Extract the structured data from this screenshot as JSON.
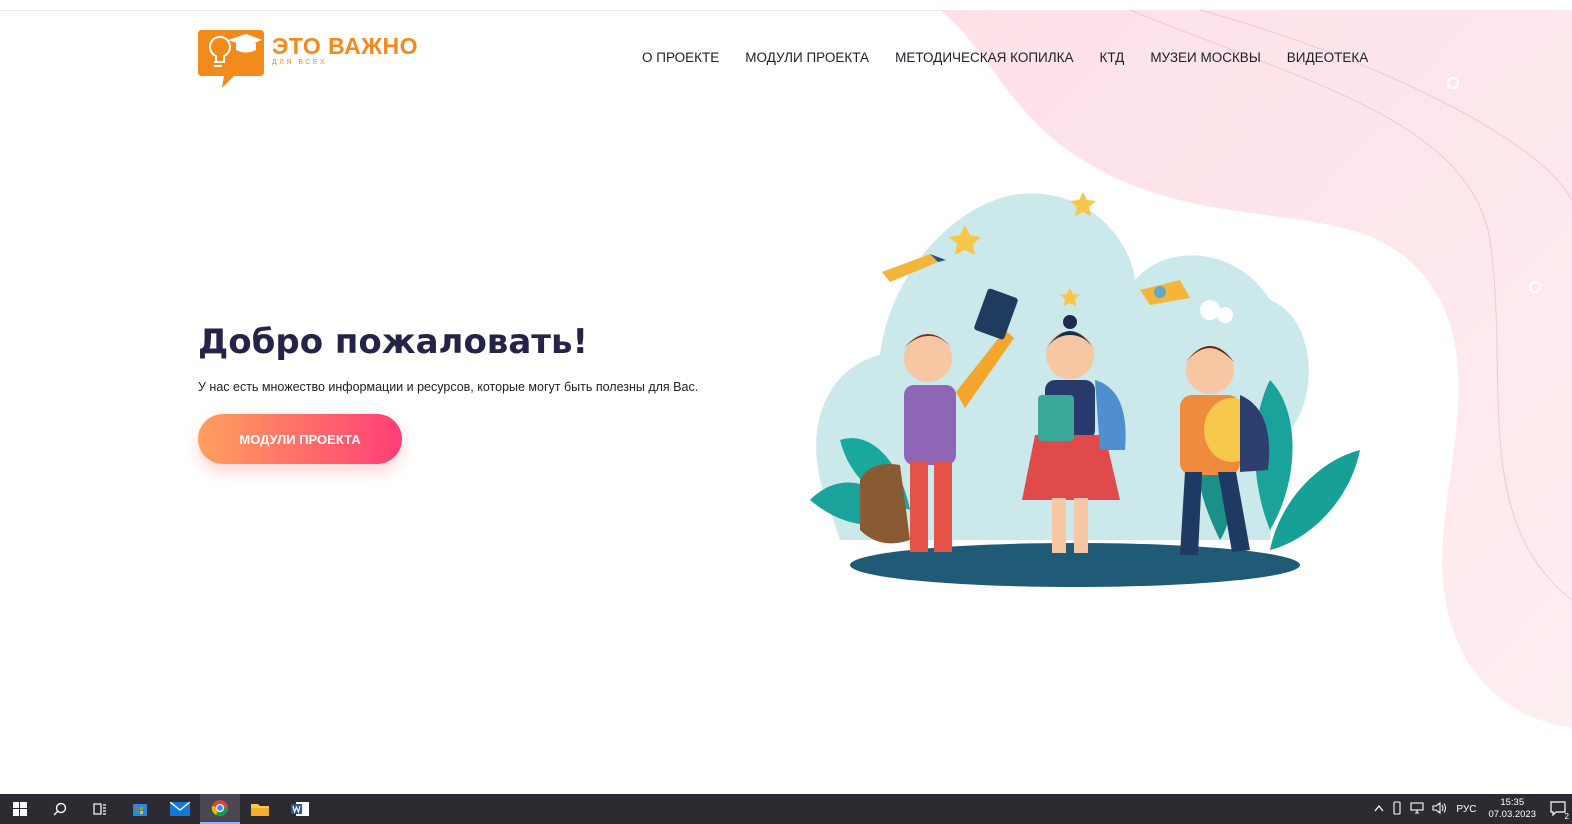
{
  "brand": {
    "title": "ЭТО ВАЖНО",
    "subtitle": "ДЛЯ ВСЕХ",
    "accent_color": "#f28a1c"
  },
  "nav": {
    "items": [
      {
        "label": "О ПРОЕКТЕ"
      },
      {
        "label": "МОДУЛИ ПРОЕКТА"
      },
      {
        "label": "МЕТОДИЧЕСКАЯ КОПИЛКА"
      },
      {
        "label": "КТД"
      },
      {
        "label": "МУЗЕИ МОСКВЫ"
      },
      {
        "label": "ВИДЕОТЕКА"
      }
    ]
  },
  "hero": {
    "title": "Добро пожаловать!",
    "text": "У нас есть множество информации и ресурсов, которые могут быть полезны для Вас.",
    "button_label": "МОДУЛИ ПРОЕКТА",
    "button_gradient": [
      "#ff9f5e",
      "#ff3d78"
    ]
  },
  "taskbar": {
    "apps": [
      "windows-start-icon",
      "search-icon",
      "task-view-icon",
      "store-icon",
      "mail-icon",
      "chrome-icon",
      "file-explorer-icon",
      "word-icon"
    ],
    "active_app": "chrome-icon",
    "language": "РУС",
    "time": "15:35",
    "date": "07.03.2023",
    "notification_count": "2"
  }
}
